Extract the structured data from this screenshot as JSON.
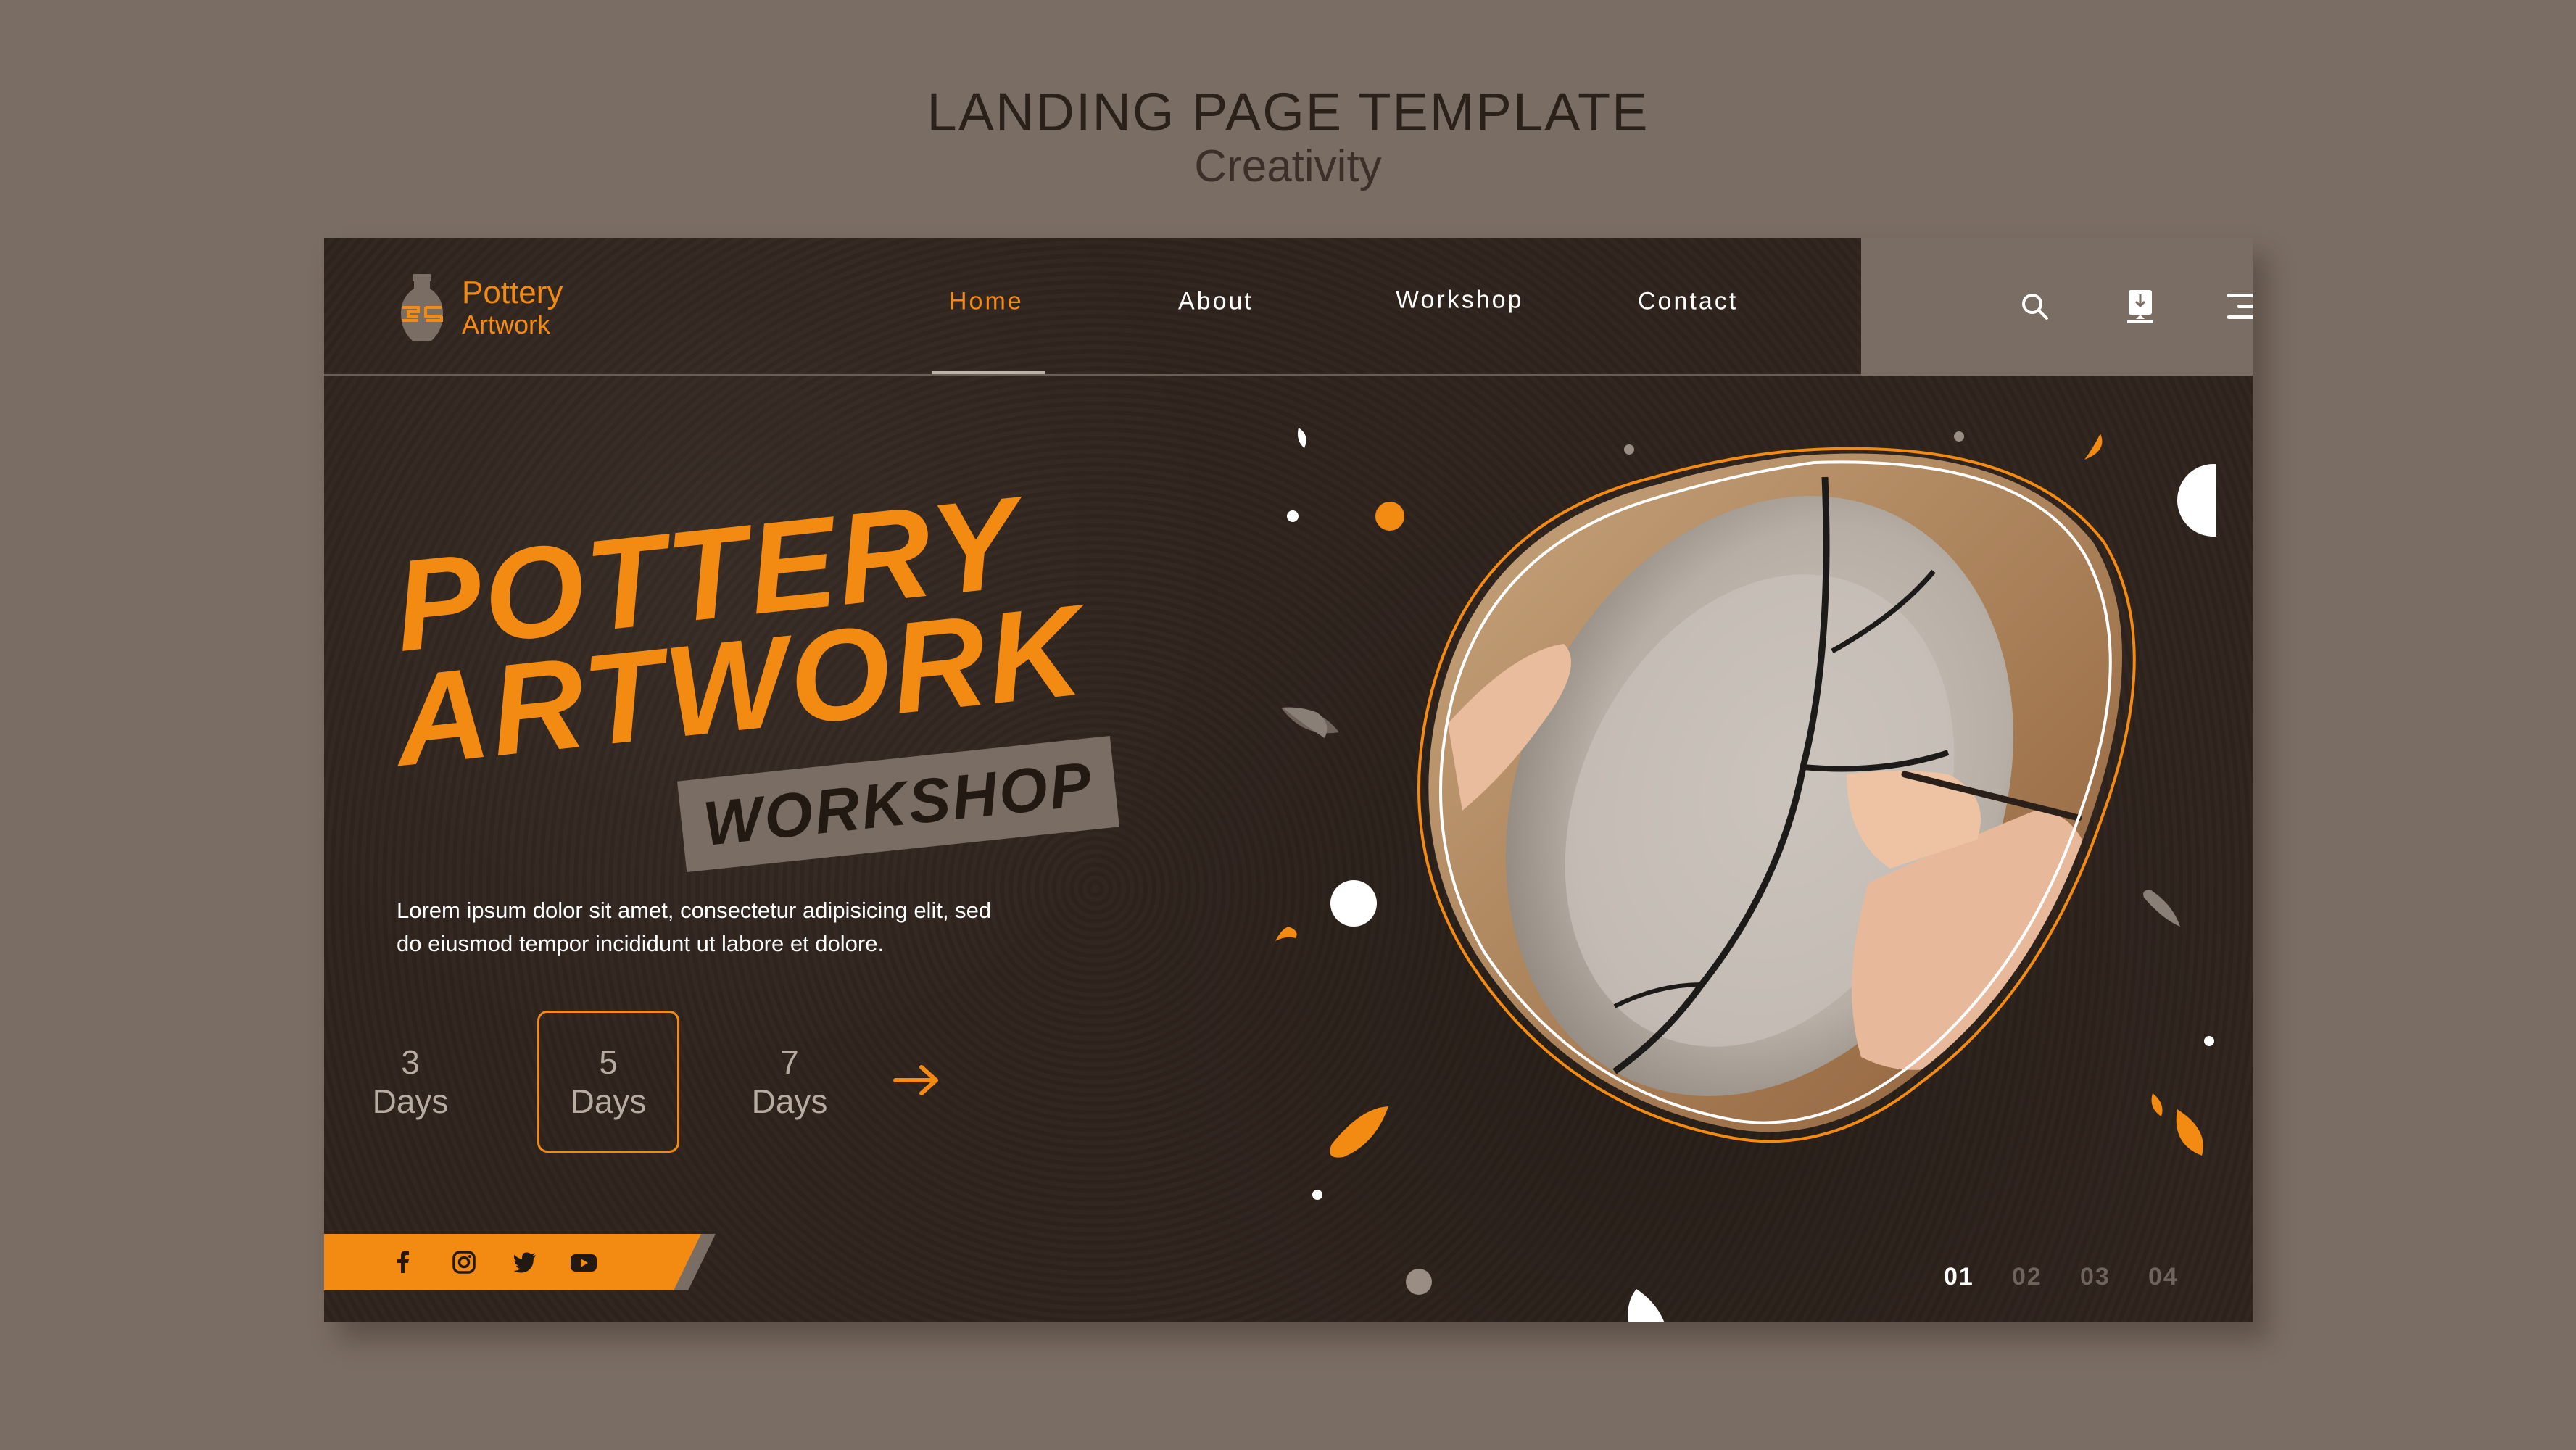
{
  "template": {
    "heading": "LANDING PAGE TEMPLATE",
    "subheading": "Creativity"
  },
  "brand": {
    "line1": "Pottery",
    "line2": "Artwork"
  },
  "nav": {
    "links": [
      "Home",
      "About",
      "Workshop",
      "Contact"
    ],
    "active": "Home",
    "icons": [
      "search-icon",
      "download-icon",
      "menu-icon"
    ]
  },
  "hero": {
    "title_line1": "POTTERY",
    "title_line2": "ARTWORK",
    "tag": "WORKSHOP",
    "description_line1": "Lorem ipsum dolor sit amet, consectetur adipisicing elit, sed",
    "description_line2": "do eiusmod tempor incididunt ut labore et dolore."
  },
  "durations": [
    {
      "number": "3",
      "unit": "Days"
    },
    {
      "number": "5",
      "unit": "Days",
      "selected": true
    },
    {
      "number": "7",
      "unit": "Days"
    }
  ],
  "social": [
    "facebook-icon",
    "instagram-icon",
    "twitter-icon",
    "youtube-icon"
  ],
  "pager": [
    "01",
    "02",
    "03",
    "04"
  ],
  "pager_active": "01",
  "colors": {
    "accent": "#f38b12",
    "background": "#2f241d",
    "muted": "#7a6d63"
  }
}
